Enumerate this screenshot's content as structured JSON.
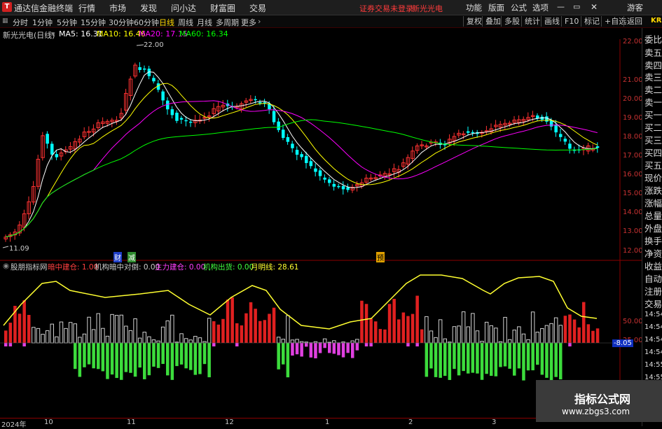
{
  "app": {
    "title": "通达信金融终端",
    "logo": "T"
  },
  "menu": [
    "行情",
    "市场",
    "发现",
    "问小达",
    "财富圈",
    "交易"
  ],
  "alert": {
    "login": "证券交易未登录",
    "stock": "新光光电"
  },
  "menu_right": [
    "功能",
    "版面",
    "公式",
    "选项"
  ],
  "guest": "游客",
  "tabs": [
    "分时",
    "1分钟",
    "5分钟",
    "15分钟",
    "30分钟",
    "60分钟",
    "日线",
    "周线",
    "月线",
    "多周期",
    "更多"
  ],
  "active_tab": "日线",
  "tab_buttons": [
    "复权",
    "叠加",
    "多股",
    "统计",
    "画线",
    "F10",
    "标记",
    "+自选",
    "返回"
  ],
  "corner_code": "KR",
  "legend": {
    "name": "新光光电(日线)",
    "ma5": "MA5: 16.31",
    "ma10": "MA10: 16.46",
    "ma20": "MA20: 17.15",
    "ma60": "MA60: 16.34"
  },
  "price_ticks": [
    "22.00",
    "21.00",
    "20.00",
    "19.00",
    "18.00",
    "17.00",
    "16.00",
    "15.00",
    "14.00",
    "13.00",
    "12.00"
  ],
  "price_annot": {
    "high": "22.00",
    "low": "11.09"
  },
  "markers": {
    "cai": "财",
    "jian": "减",
    "yu": "预"
  },
  "indicator": {
    "name": "股朋指标网",
    "a": "暗中建仓: 1.00",
    "b": "机构暗中对倒: 0.00",
    "c": "主力建仓: 0.00",
    "d": "机构出货: 0.00",
    "e": "月明线: 28.61"
  },
  "ind_ticks": [
    "50.00",
    "25.00"
  ],
  "ind_value": "-8.05",
  "right_panel": [
    "委比",
    "卖五",
    "卖四",
    "卖三",
    "卖二",
    "卖一",
    "买一",
    "买二",
    "买三",
    "买四",
    "买五",
    "现价",
    "涨跌",
    "涨幅",
    "总量",
    "外盘",
    "换手",
    "净资",
    "收益",
    "自动",
    "注册",
    "交易"
  ],
  "right_times": [
    "14:54",
    "14:54",
    "14:54",
    "14:54",
    "14:55",
    "14:55"
  ],
  "date_labels": [
    "2024年",
    "10",
    "11",
    "12",
    "1",
    "2",
    "3"
  ],
  "watermark": {
    "brand": "指标公式网",
    "url": "www.zbgs3.com"
  },
  "colors": {
    "up": "#ff3232",
    "down": "#00ffff",
    "ma5": "#ffffff",
    "ma10": "#ffff00",
    "ma20": "#ff00ff",
    "ma60": "#00ff00",
    "red_bar": "#e02020",
    "green_bar": "#3cdc3c",
    "white_bar": "#d0d0d0",
    "magenta_bar": "#e040e0",
    "yellow_line": "#ffff30"
  }
}
